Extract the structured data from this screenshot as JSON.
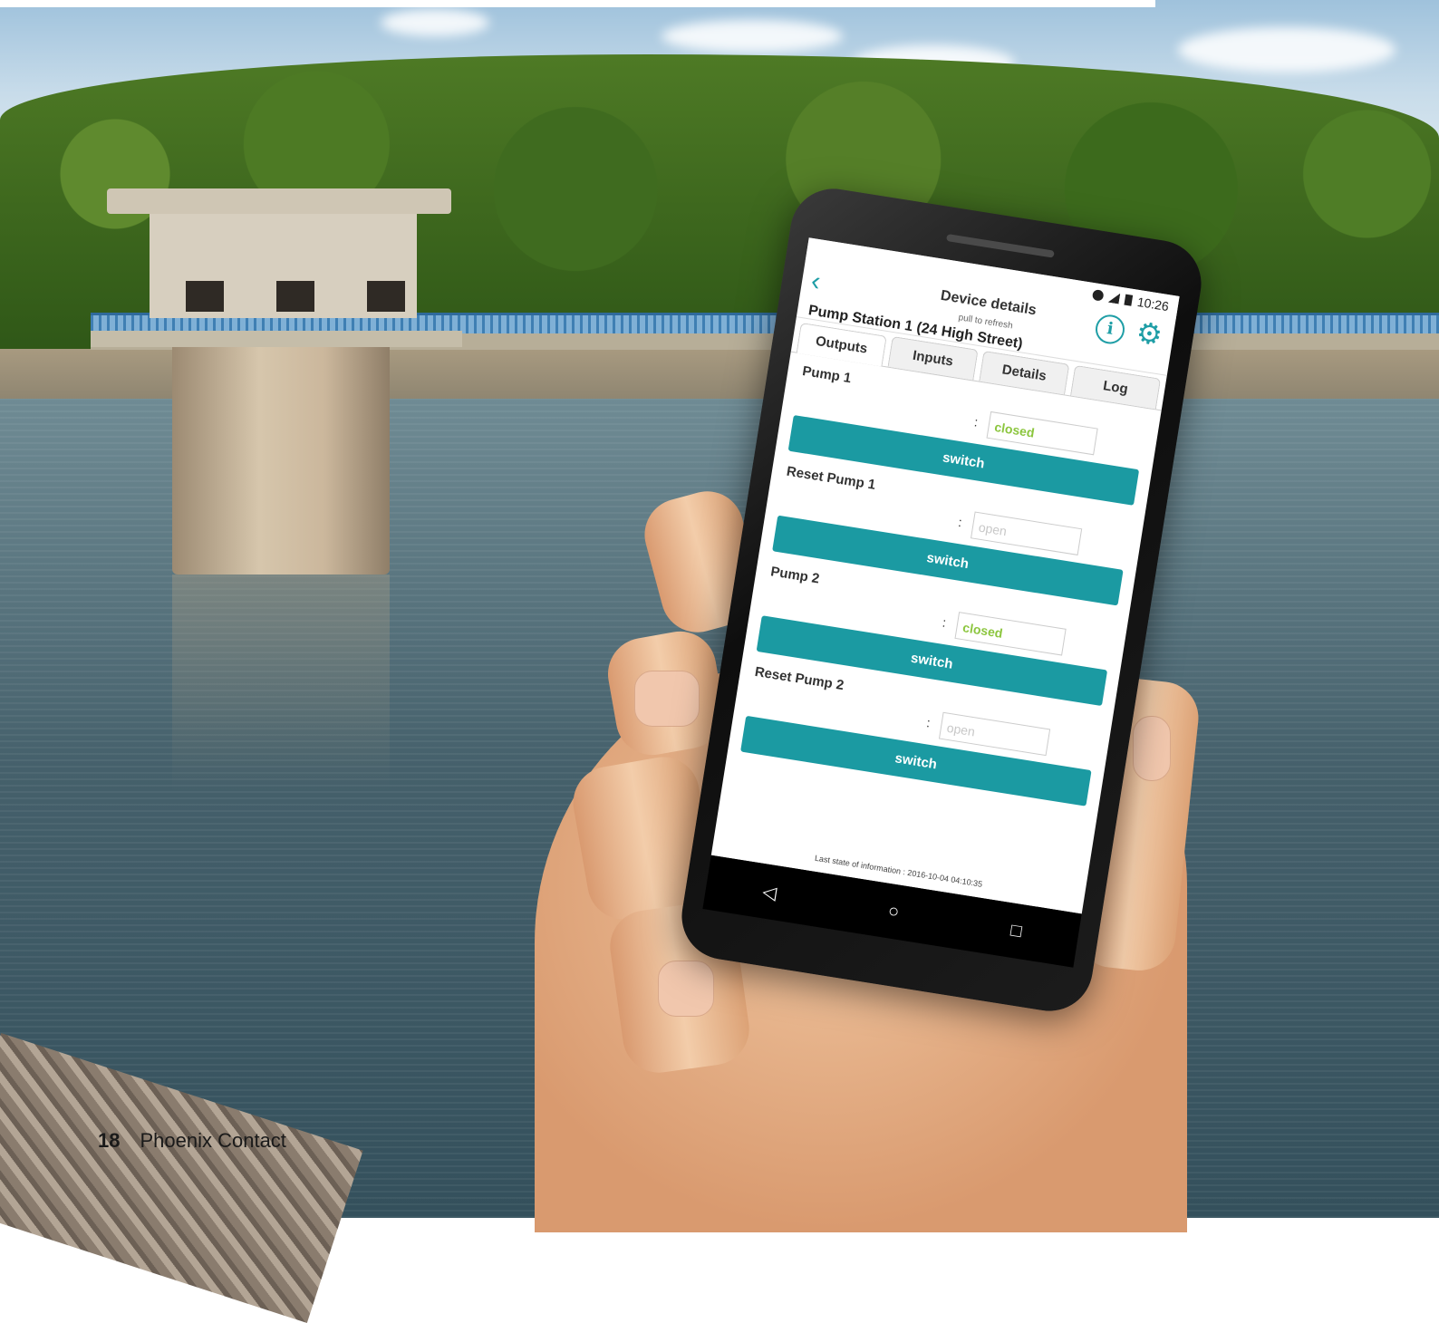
{
  "caption": {
    "page_number": "18",
    "brand": "Phoenix Contact"
  },
  "colors": {
    "accent": "#1b9aa2",
    "closed_state": "#8cc63f",
    "open_state": "#c8c8c8"
  },
  "statusbar": {
    "time": "10:26",
    "icons": [
      "dnd-icon",
      "signal-icon",
      "battery-icon"
    ]
  },
  "appbar": {
    "back_icon": "chevron-left-icon",
    "title": "Device details",
    "pull_hint": "pull to refresh",
    "info_icon": "info-icon",
    "settings_icon": "gear-icon"
  },
  "station": "Pump Station 1 (24 High Street)",
  "tabs": [
    {
      "label": "Outputs",
      "active": true
    },
    {
      "label": "Inputs",
      "active": false
    },
    {
      "label": "Details",
      "active": false
    },
    {
      "label": "Log",
      "active": false
    }
  ],
  "outputs": [
    {
      "name": "Pump 1",
      "separator": ":",
      "state": "closed",
      "button": "switch"
    },
    {
      "name": "Reset Pump 1",
      "separator": ":",
      "state": "open",
      "button": "switch"
    },
    {
      "name": "Pump 2",
      "separator": ":",
      "state": "closed",
      "button": "switch"
    },
    {
      "name": "Reset Pump 2",
      "separator": ":",
      "state": "open",
      "button": "switch"
    }
  ],
  "footer": "Last state of information : 2016-10-04 04:10:35",
  "navbar": {
    "back": "◁",
    "home": "○",
    "recents": "□"
  }
}
